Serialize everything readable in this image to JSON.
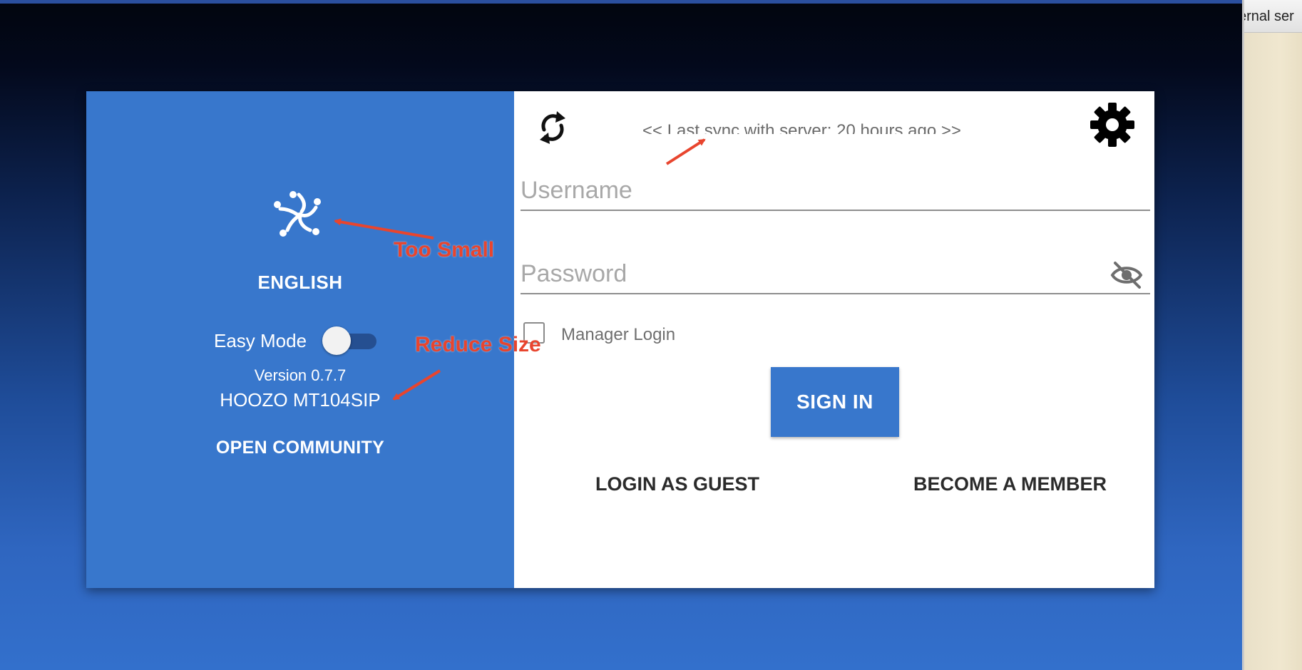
{
  "left_panel": {
    "language": "ENGLISH",
    "easy_mode_label": "Easy Mode",
    "easy_mode_on": false,
    "version": "Version 0.7.7",
    "device": "HOOZO MT104SIP",
    "community": "OPEN COMMUNITY"
  },
  "right_panel": {
    "sync_status": "<< Last sync with server: 20 hours ago >>",
    "username_placeholder": "Username",
    "password_placeholder": "Password",
    "manager_login_label": "Manager Login",
    "manager_login_checked": false,
    "sign_in_label": "SIGN IN",
    "login_guest_label": "LOGIN AS GUEST",
    "become_member_label": "BECOME A MEMBER"
  },
  "annotations": {
    "too_small": "Too Small",
    "reduce_size": "Reduce Size"
  },
  "background_window": {
    "title_fragment": "ernal ser"
  },
  "icons": {
    "logo": "community-logo-icon",
    "sync": "sync-icon",
    "settings": "gear-icon",
    "password_toggle": "eye-off-icon"
  },
  "colors": {
    "primary_blue": "#3877cc",
    "annotation_red": "#e8452e",
    "panel_white": "#ffffff"
  }
}
